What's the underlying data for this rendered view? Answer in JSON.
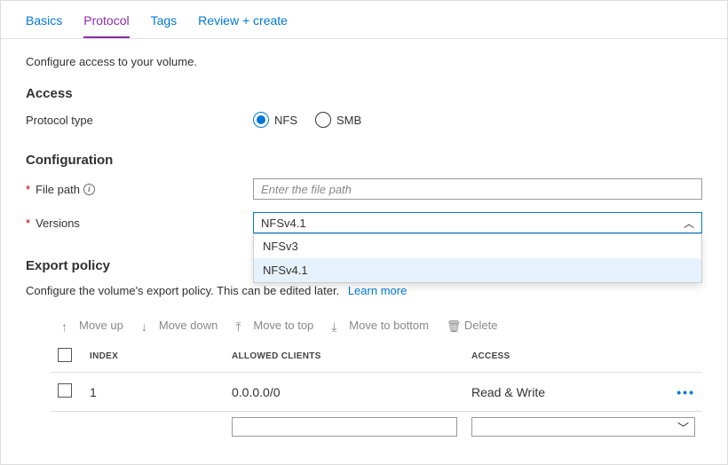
{
  "tabs": [
    "Basics",
    "Protocol",
    "Tags",
    "Review + create"
  ],
  "active_tab_index": 1,
  "description": "Configure access to your volume.",
  "access": {
    "heading": "Access",
    "protocol_label": "Protocol type",
    "options": [
      "NFS",
      "SMB"
    ],
    "selected": "NFS"
  },
  "configuration": {
    "heading": "Configuration",
    "file_path_label": "File path",
    "file_path_placeholder": "Enter the file path",
    "file_path_value": "",
    "versions_label": "Versions",
    "versions_selected": "NFSv4.1",
    "versions_options": [
      "NFSv3",
      "NFSv4.1"
    ]
  },
  "export_policy": {
    "heading": "Export policy",
    "description": "Configure the volume's export policy. This can be edited later.",
    "learn_more": "Learn more",
    "toolbar": {
      "move_up": "Move up",
      "move_down": "Move down",
      "move_top": "Move to top",
      "move_bottom": "Move to bottom",
      "delete": "Delete"
    },
    "columns": {
      "index": "INDEX",
      "allowed": "ALLOWED CLIENTS",
      "access": "ACCESS"
    },
    "rows": [
      {
        "index": "1",
        "allowed": "0.0.0.0/0",
        "access": "Read & Write"
      }
    ]
  }
}
